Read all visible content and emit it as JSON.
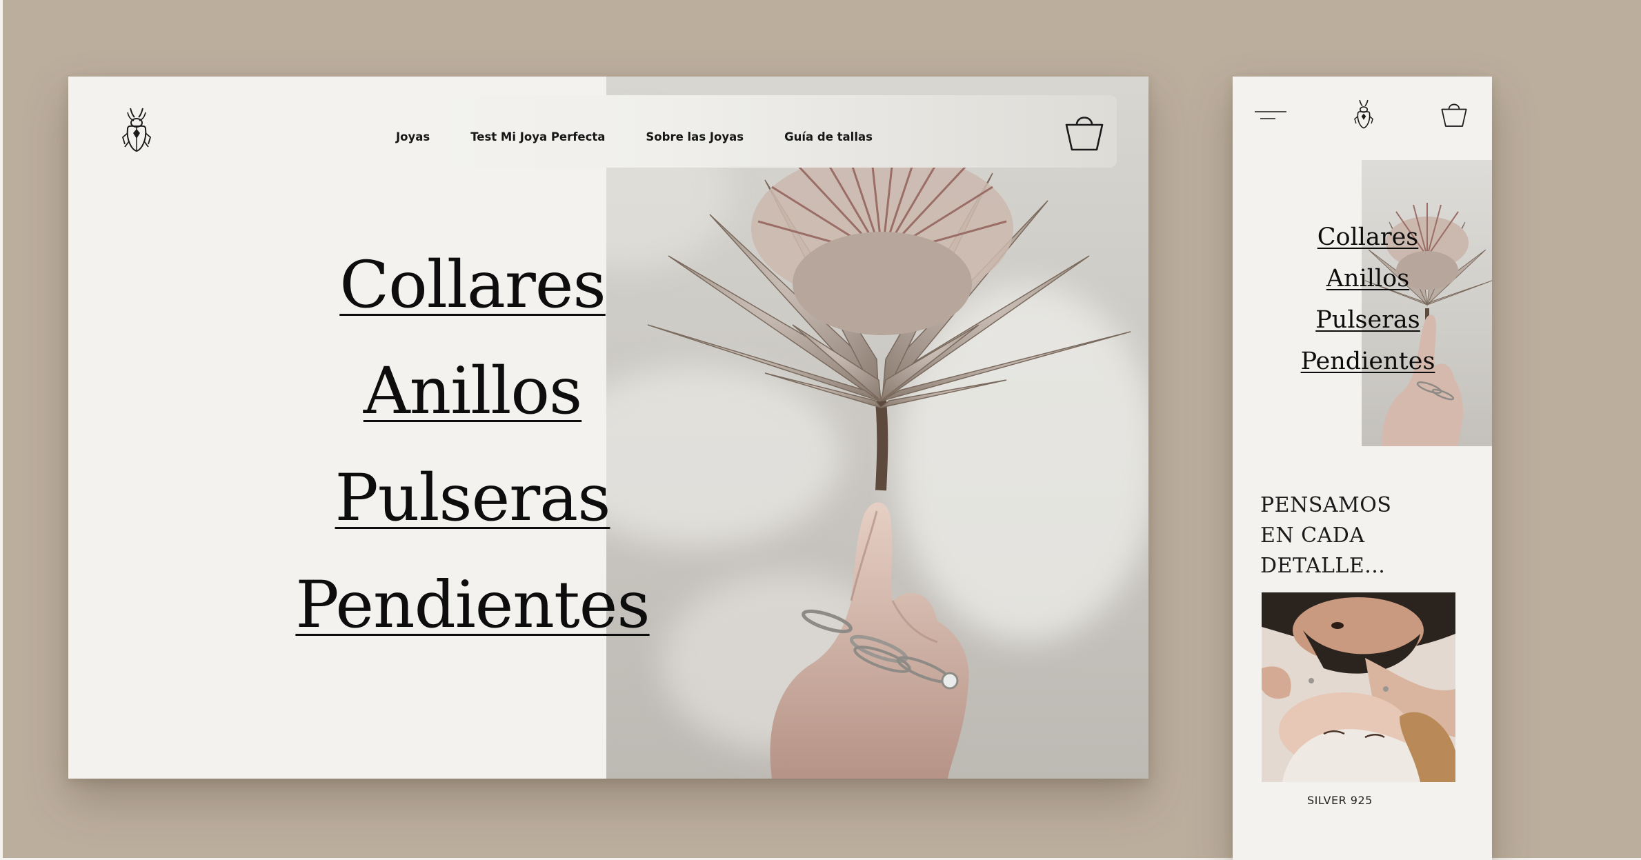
{
  "desktop": {
    "logo_icon": "beetle-logo-icon",
    "nav": [
      {
        "label": "Joyas"
      },
      {
        "label": "Test Mi Joya Perfecta"
      },
      {
        "label": "Sobre las Joyas"
      },
      {
        "label": "Guía de tallas"
      }
    ],
    "cart_icon": "shopping-basket-icon",
    "categories": [
      {
        "label": "Collares"
      },
      {
        "label": "Anillos"
      },
      {
        "label": "Pulseras"
      },
      {
        "label": "Pendientes"
      }
    ]
  },
  "mobile": {
    "menu_icon": "hamburger-menu-icon",
    "logo_icon": "beetle-logo-icon",
    "cart_icon": "shopping-basket-icon",
    "categories": [
      {
        "label": "Collares"
      },
      {
        "label": "Anillos"
      },
      {
        "label": "Pulseras"
      },
      {
        "label": "Pendientes"
      }
    ],
    "headline": "PENSAMOS\nEN CADA\nDETALLE...",
    "caption": "SILVER 925"
  },
  "colors": {
    "background": "#bcae9d",
    "page": "#f3f2ee",
    "text": "#0d0d0d"
  }
}
